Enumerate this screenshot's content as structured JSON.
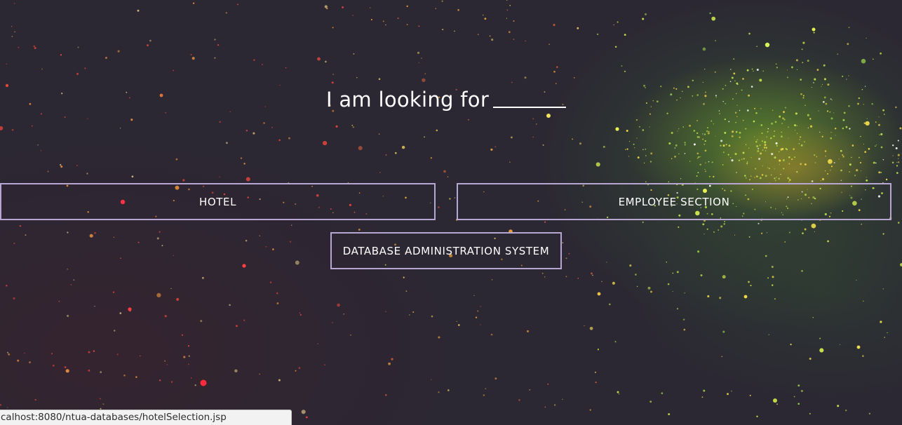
{
  "hero": {
    "heading": "I am looking for"
  },
  "buttons": {
    "hotel": "HOTEL",
    "employee_section": "EMPLOYEE SECTION",
    "database_admin": "DATABASE ADMINISTRATION SYSTEM"
  },
  "status_bar": {
    "url": "calhost:8080/ntua-databases/hotelSelection.jsp"
  },
  "colors": {
    "background": "#2b2733",
    "button_border": "#b7a6d2",
    "text": "#ffffff"
  }
}
